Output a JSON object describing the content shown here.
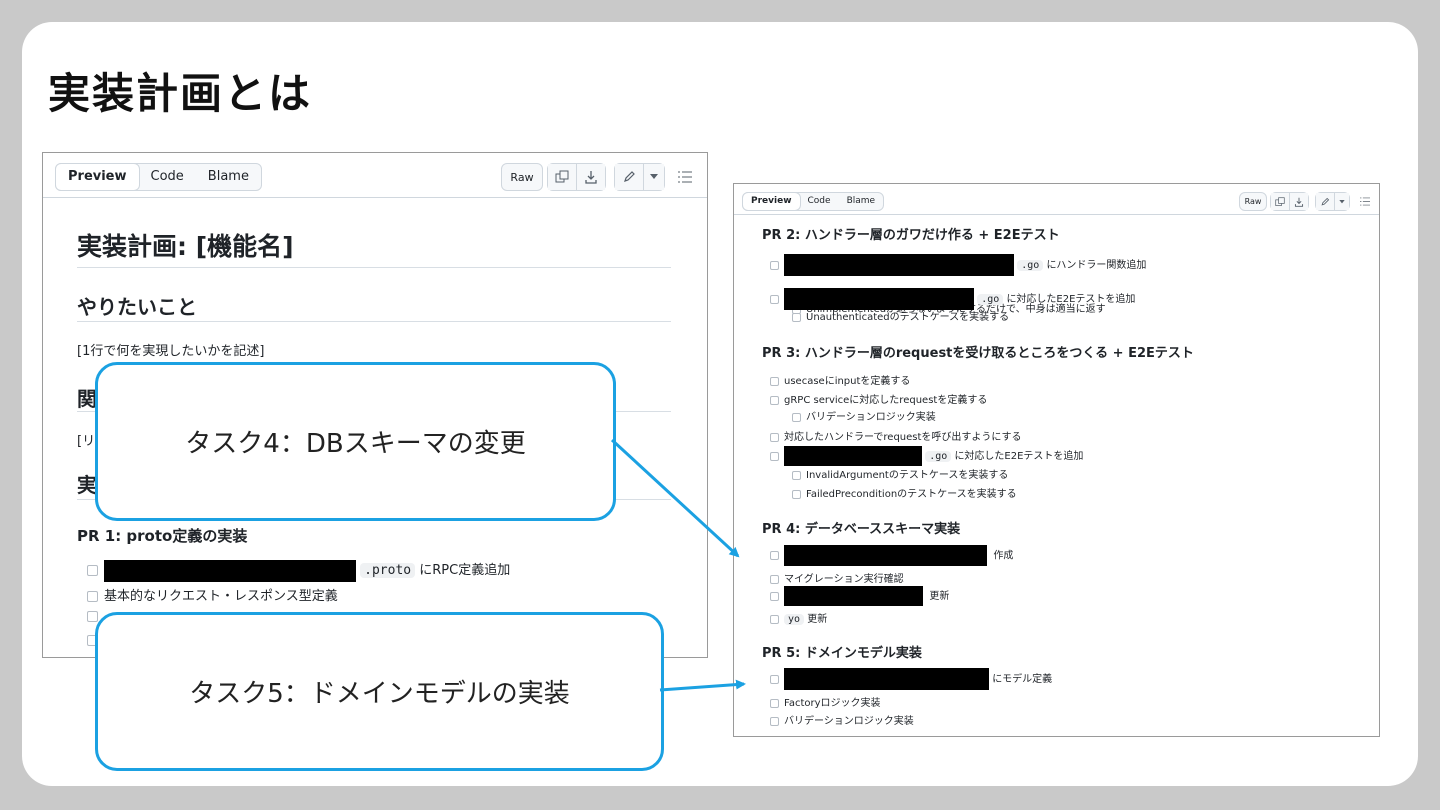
{
  "slide": {
    "title": "実装計画とは"
  },
  "colors": {
    "callout_border": "#1ba1e2",
    "redaction": "#000000"
  },
  "toolbar": {
    "tabs": [
      "Preview",
      "Code",
      "Blame"
    ],
    "raw_label": "Raw",
    "icons": [
      "copy-icon",
      "download-icon",
      "pencil-icon",
      "caret-down-icon",
      "outline-list-icon"
    ]
  },
  "left_doc": {
    "h1": "実装計画: [機能名]",
    "want_heading": "やりたいこと",
    "want_text": "[1行で何を実現したいかを記述]",
    "related_heading_visible": "関",
    "related_text_visible": "[リ",
    "impl_heading_visible": "実",
    "pr1_heading": "PR 1: proto定義の実装",
    "pr1_items": [
      {
        "code": ".proto",
        "text": "にRPC定義追加"
      },
      {
        "text": "基本的なリクエスト・レスポンス型定義"
      }
    ]
  },
  "right_doc": {
    "pr2": {
      "heading": "PR 2: ハンドラー層のガワだけ作る + E2Eテスト",
      "items": [
        {
          "code": ".go",
          "text": "にハンドラー関数追加"
        },
        {
          "text": "Unimplementedが返らないようにするだけで、中身は適当に返す",
          "indent": true
        },
        {
          "code": ".go",
          "text": "に対応したE2Eテストを追加"
        },
        {
          "text": "Unauthenticatedのテストケースを実装する",
          "indent": true
        }
      ]
    },
    "pr3": {
      "heading": "PR 3: ハンドラー層のrequestを受け取るところをつくる + E2Eテスト",
      "items": [
        {
          "text": "usecaseにinputを定義する"
        },
        {
          "text": "gRPC serviceに対応したrequestを定義する"
        },
        {
          "text": "バリデーションロジック実装",
          "indent": true
        },
        {
          "text": "対応したハンドラーでrequestを呼び出すようにする"
        },
        {
          "code": ".go",
          "text": "に対応したE2Eテストを追加"
        },
        {
          "text": "InvalidArgumentのテストケースを実装する",
          "indent": true
        },
        {
          "text": "FailedPreconditionのテストケースを実装する",
          "indent": true
        }
      ]
    },
    "pr4": {
      "heading": "PR 4: データベーススキーマ実装",
      "items": [
        {
          "text": "作成"
        },
        {
          "text": "マイグレーション実行確認"
        },
        {
          "text": "更新"
        },
        {
          "code": "yo",
          "text": "更新"
        }
      ]
    },
    "pr5": {
      "heading": "PR 5: ドメインモデル実装",
      "items": [
        {
          "text": "にモデル定義"
        },
        {
          "text": "Factoryロジック実装"
        },
        {
          "text": "バリデーションロジック実装"
        }
      ]
    }
  },
  "callouts": {
    "task4": "タスク4：DBスキーマの変更",
    "task5": "タスク5：ドメインモデルの実装"
  }
}
